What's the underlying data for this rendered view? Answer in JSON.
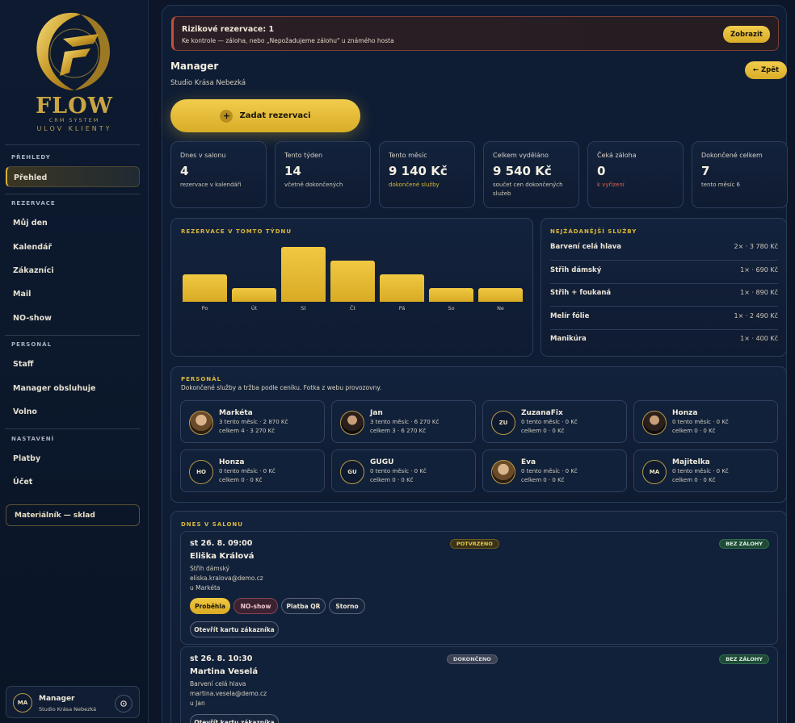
{
  "brand": {
    "name": "FLOW",
    "subtitle": "CRM SYSTEM",
    "tagline": "ULOV KLIENTY"
  },
  "sidebar": {
    "sections": [
      {
        "title": "PŘEHLEDY",
        "items": [
          {
            "label": "Přehled",
            "active": true
          }
        ]
      },
      {
        "title": "REZERVACE",
        "items": [
          {
            "label": "Můj den"
          },
          {
            "label": "Kalendář"
          },
          {
            "label": "Zákazníci"
          },
          {
            "label": "Mail"
          },
          {
            "label": "NO-show"
          }
        ]
      },
      {
        "title": "PERSONÁL",
        "items": [
          {
            "label": "Staff"
          },
          {
            "label": "Manager obsluhuje"
          },
          {
            "label": "Volno"
          }
        ]
      },
      {
        "title": "NASTAVENÍ",
        "items": [
          {
            "label": "Platby"
          },
          {
            "label": "Účet"
          }
        ]
      }
    ],
    "material_button": "Materiálník — sklad",
    "user": {
      "initials": "MA",
      "name": "Manager",
      "studio": "Studio Krása Nebezká"
    }
  },
  "alert": {
    "title": "Rizikové rezervace: 1",
    "text": "Ke kontrole — záloha, nebo „Nepožadujeme zálohu\" u známého hosta",
    "button": "Zobrazit"
  },
  "header": {
    "title": "Manager",
    "subtitle": "Studio Krása Nebezká",
    "back_button": "← Zpět",
    "add_button": "Zadat rezervaci"
  },
  "stats": [
    {
      "label": "Dnes v salonu",
      "value": "4",
      "sub": "rezervace v kalendáři",
      "sub_color": "#cfcabb"
    },
    {
      "label": "Tento týden",
      "value": "14",
      "sub": "včetně dokončených",
      "sub_color": "#cfcabb"
    },
    {
      "label": "Tento měsíc",
      "value": "9 140 Kč",
      "sub": "dokončené služby",
      "sub_color": "#d8b83c"
    },
    {
      "label": "Celkem vyděláno",
      "value": "9 540 Kč",
      "sub": "součet cen dokončených služeb",
      "sub_color": "#cfcabb"
    },
    {
      "label": "Čeká záloha",
      "value": "0",
      "sub": "k vyřízení",
      "sub_color": "#e0604e"
    },
    {
      "label": "Dokončené celkem",
      "value": "7",
      "sub": "tento měsíc 6",
      "sub_color": "#cfcabb"
    }
  ],
  "week_chart": {
    "title": "REZERVACE V TOMTO TÝDNU",
    "chart_data": {
      "type": "bar",
      "categories": [
        "Po",
        "Út",
        "St",
        "Čt",
        "Pá",
        "So",
        "Ne"
      ],
      "values": [
        2,
        1,
        4,
        3,
        2,
        1,
        1
      ]
    }
  },
  "top_services": {
    "title": "NEJŽÁDANĚJŠÍ SLUŽBY",
    "items": [
      {
        "name": "Barvení celá hlava",
        "info": "2× · 3 780 Kč"
      },
      {
        "name": "Střih dámský",
        "info": "1× · 690 Kč"
      },
      {
        "name": "Střih + foukaná",
        "info": "1× · 890 Kč"
      },
      {
        "name": "Melír fólie",
        "info": "1× · 2 490 Kč"
      },
      {
        "name": "Manikúra",
        "info": "1× · 400 Kč"
      }
    ]
  },
  "staff": {
    "title": "PERSONÁL",
    "subtitle": "Dokončené služby a tržba podle ceníku. Fotka z webu provozovny.",
    "members": [
      {
        "name": "Markéta",
        "line1": "3 tento měsíc · 2 870 Kč",
        "line2": "celkem 4 · 3 270 Kč",
        "photo": "light",
        "initials": ""
      },
      {
        "name": "Jan",
        "line1": "3 tento měsíc · 6 270 Kč",
        "line2": "celkem 3 · 6 270 Kč",
        "photo": "dark",
        "initials": ""
      },
      {
        "name": "ZuzanaFix",
        "line1": "0 tento měsíc · 0 Kč",
        "line2": "celkem 0 · 0 Kč",
        "photo": "",
        "initials": "ZU"
      },
      {
        "name": "Honza",
        "line1": "0 tento měsíc · 0 Kč",
        "line2": "celkem 0 · 0 Kč",
        "photo": "dark",
        "initials": ""
      },
      {
        "name": "Honza",
        "line1": "0 tento měsíc · 0 Kč",
        "line2": "celkem 0 · 0 Kč",
        "photo": "",
        "initials": "HO"
      },
      {
        "name": "GUGU",
        "line1": "0 tento měsíc · 0 Kč",
        "line2": "celkem 0 · 0 Kč",
        "photo": "",
        "initials": "GU"
      },
      {
        "name": "Eva",
        "line1": "0 tento měsíc · 0 Kč",
        "line2": "celkem 0 · 0 Kč",
        "photo": "light",
        "initials": ""
      },
      {
        "name": "Majitelka",
        "line1": "0 tento měsíc · 0 Kč",
        "line2": "celkem 0 · 0 Kč",
        "photo": "",
        "initials": "MA"
      }
    ]
  },
  "today": {
    "title": "DNES V SALONU",
    "reservations": [
      {
        "time": "st 26. 8. 09:00",
        "name": "Eliška Králová",
        "service": "Střih dámský",
        "email": "eliska.kralova@demo.cz",
        "staff": "u Markéta",
        "status": "POTVRZENO",
        "deposit": "BEZ ZÁLOHY",
        "actions": [
          "Proběhla",
          "NO-show",
          "Platba QR",
          "Storno"
        ],
        "card_button": "Otevřít kartu zákazníka"
      },
      {
        "time": "st 26. 8. 10:30",
        "name": "Martina Veselá",
        "service": "Barvení celá hlava",
        "email": "martina.vesela@demo.cz",
        "staff": "u Jan",
        "status": "DOKONČENO",
        "deposit": "BEZ ZÁLOHY",
        "actions": [],
        "card_button": "Otevřít kartu zákazníka"
      }
    ]
  },
  "colors": {
    "gold": "#d8b334",
    "background": "#0c1628",
    "danger": "#c2503a",
    "success": "#2f6e4f"
  }
}
